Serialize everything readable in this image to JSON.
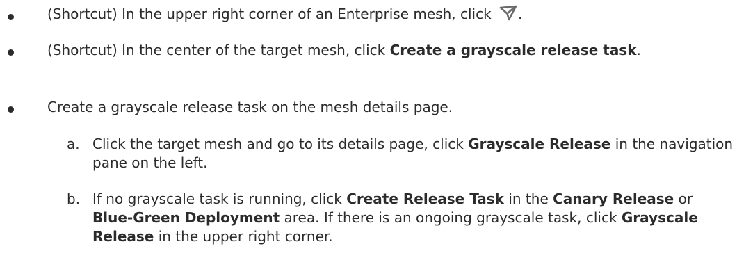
{
  "bullets": [
    {
      "prefix": "(Shortcut) In the upper right corner of an Enterprise mesh, click ",
      "icon": "send-icon",
      "suffix": "."
    },
    {
      "prefix": "(Shortcut) In the center of the target mesh, click ",
      "bold": "Create a grayscale release task",
      "suffix": "."
    },
    {
      "text": "Create a grayscale release task on the mesh details page."
    }
  ],
  "substeps": [
    {
      "marker": "a.",
      "text1": "Click the target mesh and go to its details page, click ",
      "bold1": "Grayscale Release",
      "text2": " in the navigation pane on the left."
    },
    {
      "marker": "b.",
      "text1": "If no grayscale task is running, click ",
      "bold1": "Create Release Task",
      "text2": " in the ",
      "bold2": "Canary Release",
      "text3": " or ",
      "bold3": "Blue-Green Deployment",
      "text4": " area. If there is an ongoing grayscale task, click ",
      "bold4": "Grayscale Release",
      "text5": " in the upper right corner."
    }
  ],
  "colors": {
    "text": "#2b2b2b",
    "icon": "#6b6b6b"
  }
}
